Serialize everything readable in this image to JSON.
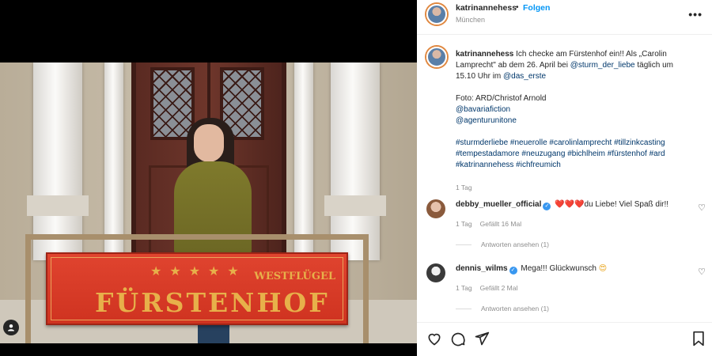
{
  "photo": {
    "sign_title": "FÜRSTENHOF",
    "sign_subtitle": "WESTFLÜGEL",
    "sign_stars": "★★★★★"
  },
  "header": {
    "username": "katrinannehess",
    "separator": "•",
    "follow_label": "Folgen",
    "location": "München",
    "more_icon": "more-horizontal-icon"
  },
  "caption": {
    "username": "katrinannehess",
    "line1_a": "Ich checke am Fürstenhof ein!! Als „Carolin",
    "line2_a": "Lamprecht\" ab dem 26. April bei ",
    "mention_sturm": "@sturm_der_liebe",
    "line2_b": " täglich um",
    "line3_a": "15.10 Uhr im ",
    "mention_erste": "@das_erste",
    "photo_credit": "Foto: ARD/Christof Arnold",
    "mention_bavaria": "@bavariafiction",
    "mention_agentur": "@agenturunitone",
    "hashtags_1": "#sturmderliebe #neuerolle #carolinlamprecht #tillzinkcasting",
    "hashtags_2": "#tempestadamore #neuzugang #bichlheim #fürstenhof #ard",
    "hashtags_3": "#katrinannehess #ichfreumich",
    "time": "1 Tag"
  },
  "comments": [
    {
      "username": "debby_mueller_official",
      "hearts": "❤️❤️❤️",
      "text": "du Liebe! Viel Spaß dir!!",
      "time": "1 Tag",
      "likes": "Gefällt 16 Mal",
      "replies": "Antworten ansehen (1)"
    },
    {
      "username": "dennis_wilms",
      "text": "Mega!!! Glückwunsch",
      "emoji": "😍",
      "time": "1 Tag",
      "likes": "Gefällt 2 Mal",
      "replies": "Antworten ansehen (1)"
    }
  ],
  "colors": {
    "accent": "#0095f6",
    "link": "#00376b",
    "muted": "#8e8e8e",
    "verified": "#3897f0"
  }
}
